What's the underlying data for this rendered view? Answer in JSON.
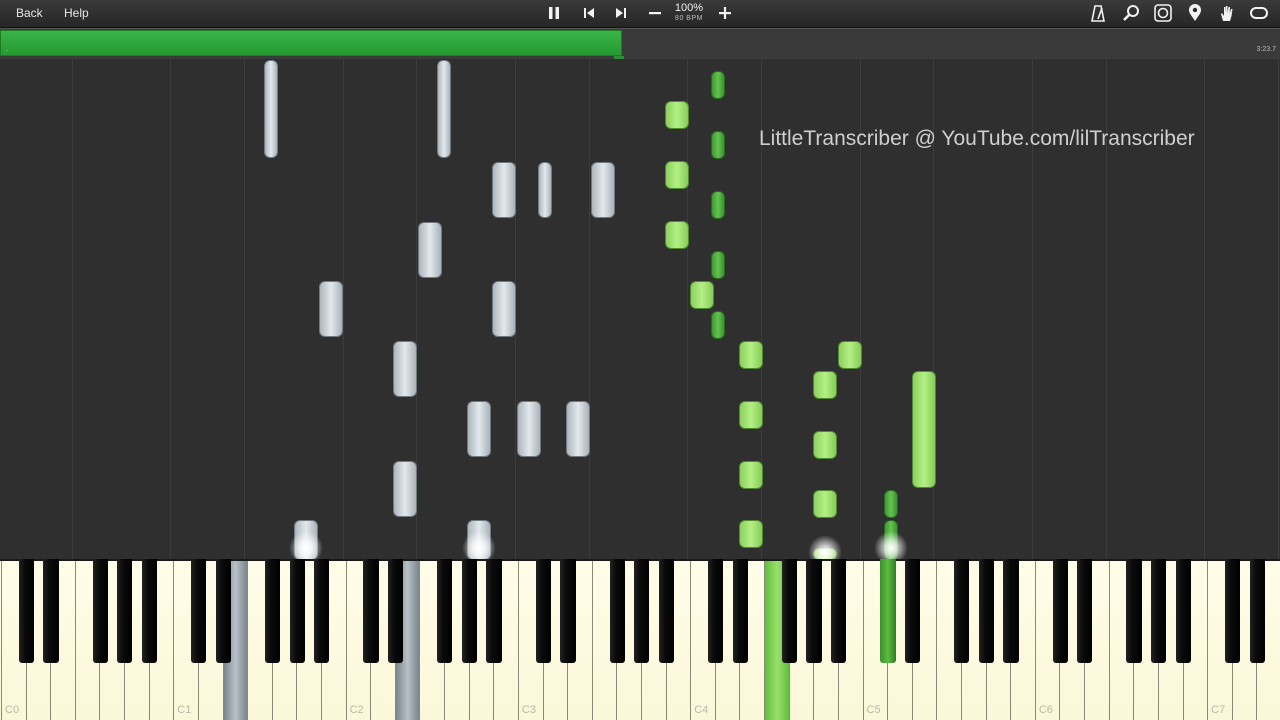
{
  "toolbar": {
    "back_label": "Back",
    "help_label": "Help",
    "zoom_value": "100%",
    "zoom_sub": "80 BPM",
    "icons": {
      "pause": "pause-icon",
      "previous": "skip-back-icon",
      "next": "skip-forward-icon",
      "minus": "minus-icon",
      "plus": "plus-icon",
      "metronome": "metronome-icon",
      "zoom": "magnifier-icon",
      "visual": "visualization-icon",
      "location": "location-pin-icon",
      "hand": "hand-icon",
      "loop": "loop-icon"
    }
  },
  "progress": {
    "fraction": 0.486,
    "start_label": ".",
    "end_label": "3:23.7"
  },
  "watermark": "LittleTranscriber @ YouTube.com/lilTranscriber",
  "colors": {
    "left_hand": "#c8d0d6",
    "right_hand": "#9be06c",
    "right_hand_dark": "#4fae40",
    "progress": "#2fad3c"
  },
  "keyboard": {
    "octave_labels": [
      "C0",
      "C1",
      "C2",
      "C3",
      "C4",
      "C5",
      "C6",
      "C7"
    ]
  }
}
